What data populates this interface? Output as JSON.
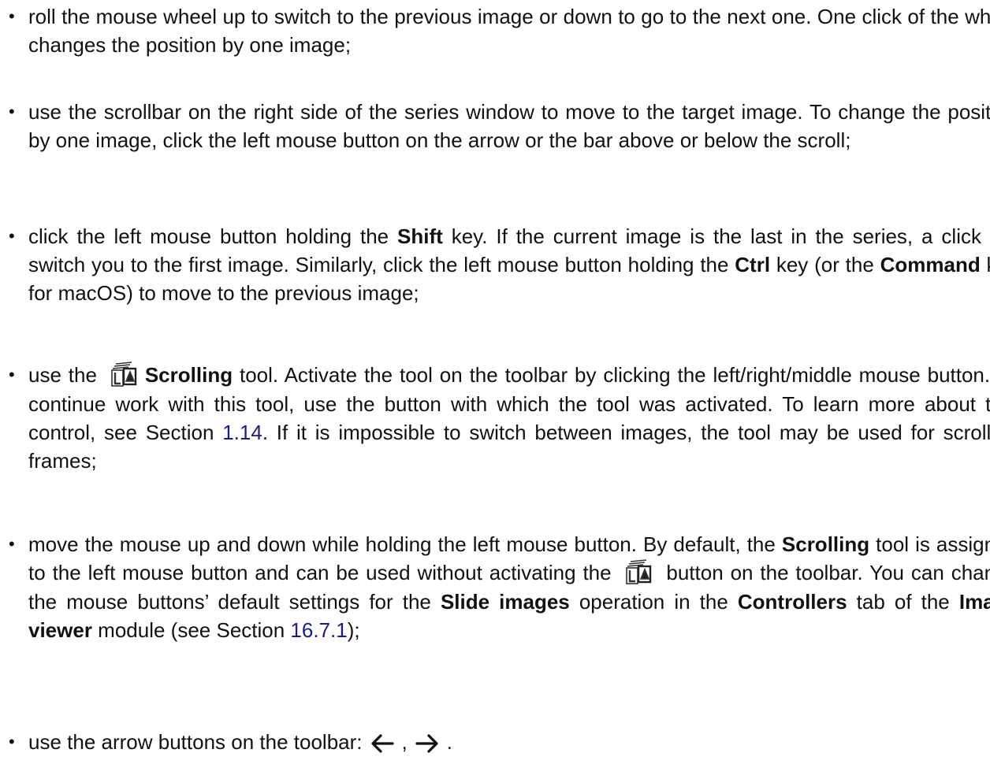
{
  "items": [
    {
      "p1": "roll the mouse wheel up to switch to the previous image or down to go to the next one. One click of the wheel changes the position by one image;"
    },
    {
      "p1": "use the scrollbar on the right side of the series window to move to the target image. To change the position by one image, click the left mouse button on the arrow or the bar above or below the scroll;"
    },
    {
      "p1": "click the left mouse button holding the ",
      "b1": "Shift",
      "p2": " key. If the current image is the last in the series, a click will switch you to the first image. Similarly, click the left mouse button holding the ",
      "b2": "Ctrl",
      "p3": " key (or the ",
      "b3": "Command",
      "p4": " key for macOS) to move to the previous image;"
    },
    {
      "p1": "use the ",
      "b1": "Scrolling",
      "p2": " tool. Activate the tool on the toolbar by clicking the left/right/middle mouse button. To continue work with this tool, use the button with which the tool was activated. To learn more about tool control, see Section ",
      "ref": "1.14",
      "p3": ". If it is impossible to switch between images, the tool may be used for scrolling frames;"
    },
    {
      "p1": "move the mouse up and down while holding the left mouse button. By default, the ",
      "b1": "Scrolling",
      "p2": " tool is assigned to the left mouse button and can be used without activating the ",
      "p3": " button on the toolbar. You can change the mouse buttons’ default settings for the ",
      "b2": "Slide images",
      "p4": " operation in the ",
      "b3": "Controllers",
      "p5": " tab of the ",
      "b4": "Image viewer",
      "p6": " module (see Section ",
      "ref": "16.7.1",
      "p7": ");"
    },
    {
      "p1": "use the arrow buttons on the toolbar:",
      "sep": ",",
      "end": "."
    }
  ],
  "icons": {
    "scrolling_tool": "scrolling-tool-icon",
    "arrow_left": "arrow-left-icon",
    "arrow_right": "arrow-right-icon"
  },
  "colors": {
    "link": "#1a1a8c",
    "text": "#111111"
  }
}
